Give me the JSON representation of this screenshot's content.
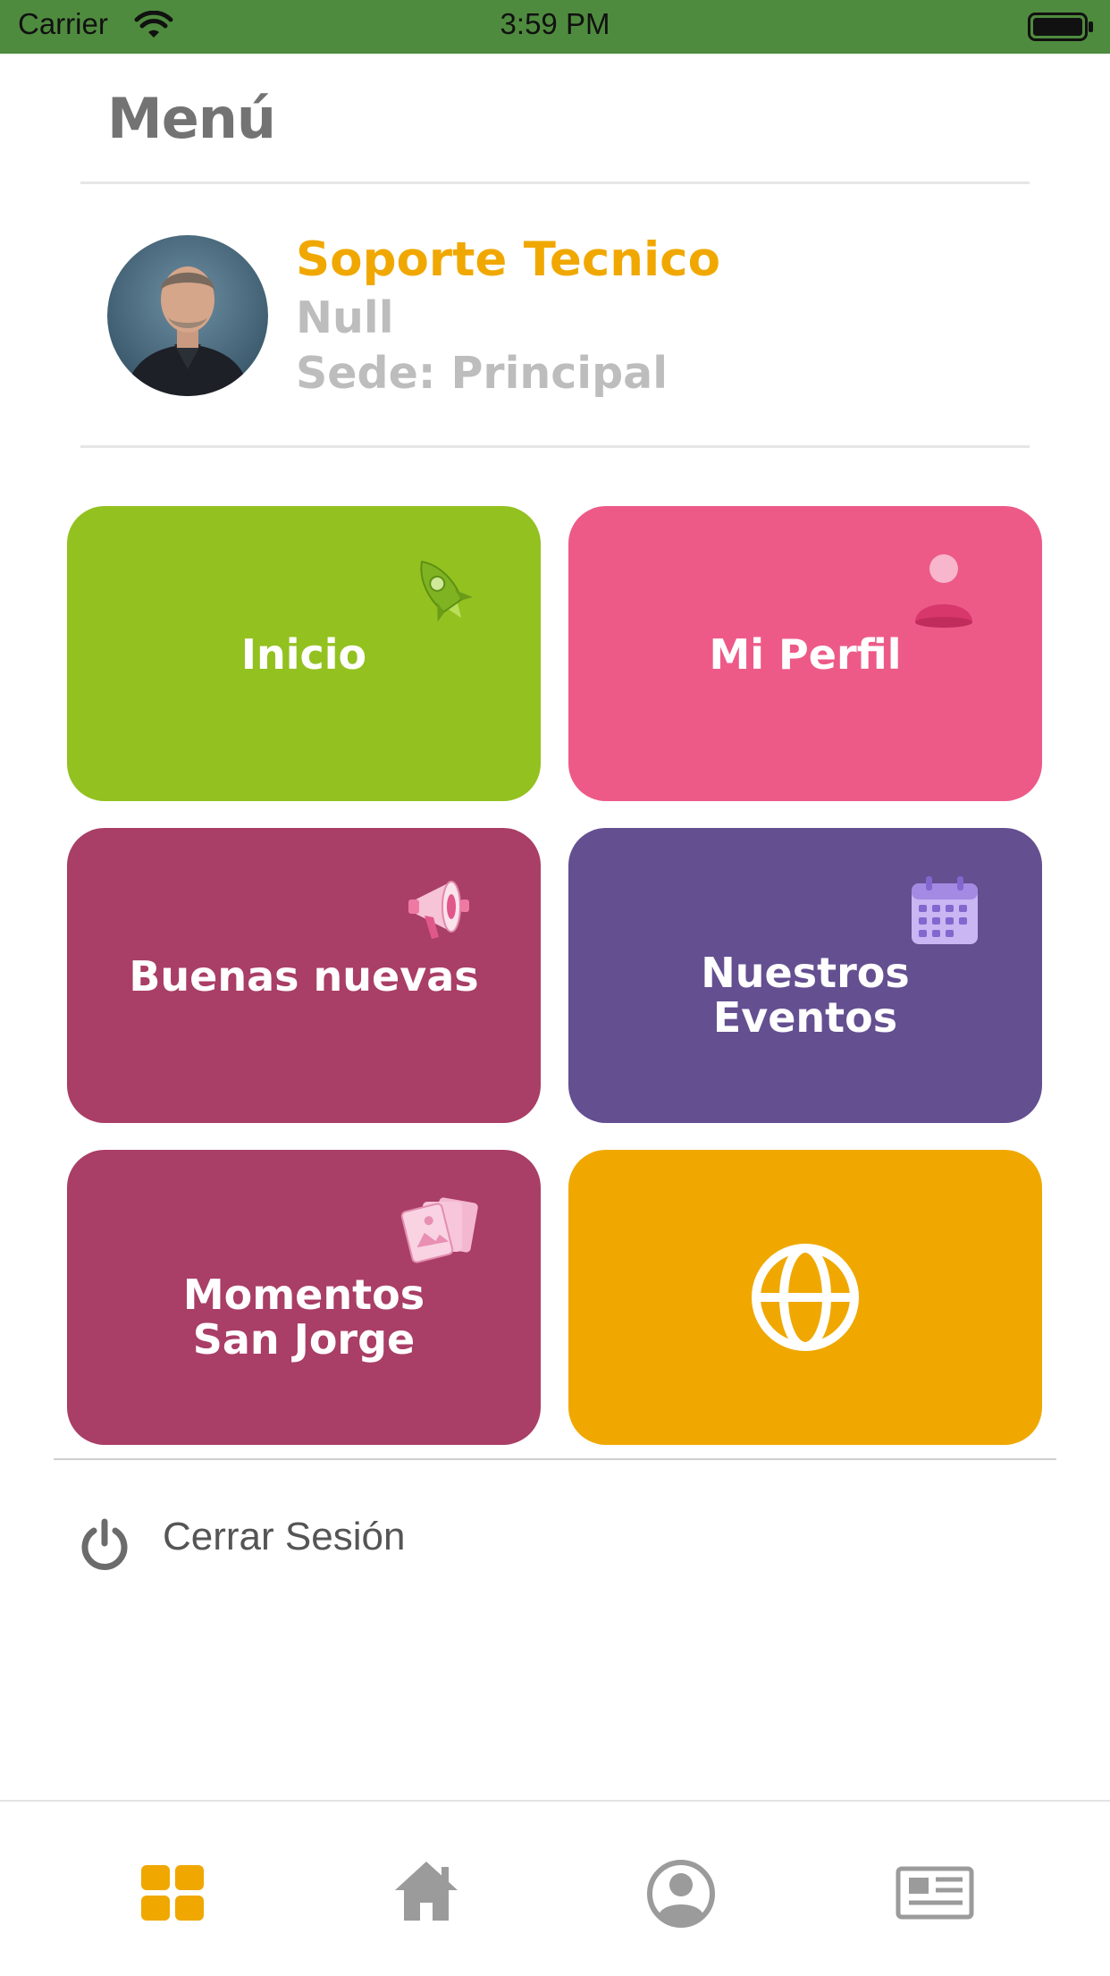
{
  "status_bar": {
    "carrier": "Carrier",
    "time": "3:59 PM"
  },
  "menu": {
    "title": "Menú"
  },
  "user": {
    "name": "Soporte Tecnico",
    "line2": "Null",
    "branch": "Sede: Principal"
  },
  "tiles": [
    {
      "label": "Inicio",
      "color": "#93c120",
      "icon": "rocket-icon"
    },
    {
      "label": "Mi Perfil",
      "color": "#ed5a88",
      "icon": "person-icon"
    },
    {
      "label": "Buenas nuevas",
      "color": "#a93e66",
      "icon": "megaphone-icon"
    },
    {
      "label_line1": "Nuestros",
      "label_line2": "Eventos",
      "color": "#644f91",
      "icon": "calendar-icon"
    },
    {
      "label_line1": "Momentos",
      "label_line2": "San Jorge",
      "color": "#a93e66",
      "icon": "photos-icon"
    },
    {
      "label": "",
      "color": "#f0a800",
      "icon": "globe-icon"
    }
  ],
  "logout": {
    "label": "Cerrar Sesión",
    "icon": "power-icon"
  },
  "tabbar": {
    "active_color": "#f0a800",
    "inactive_color": "#9b9b9b",
    "tabs": [
      {
        "icon": "grid-icon",
        "active": true
      },
      {
        "icon": "home-icon",
        "active": false
      },
      {
        "icon": "user-circle-icon",
        "active": false
      },
      {
        "icon": "newspaper-icon",
        "active": false
      }
    ]
  }
}
